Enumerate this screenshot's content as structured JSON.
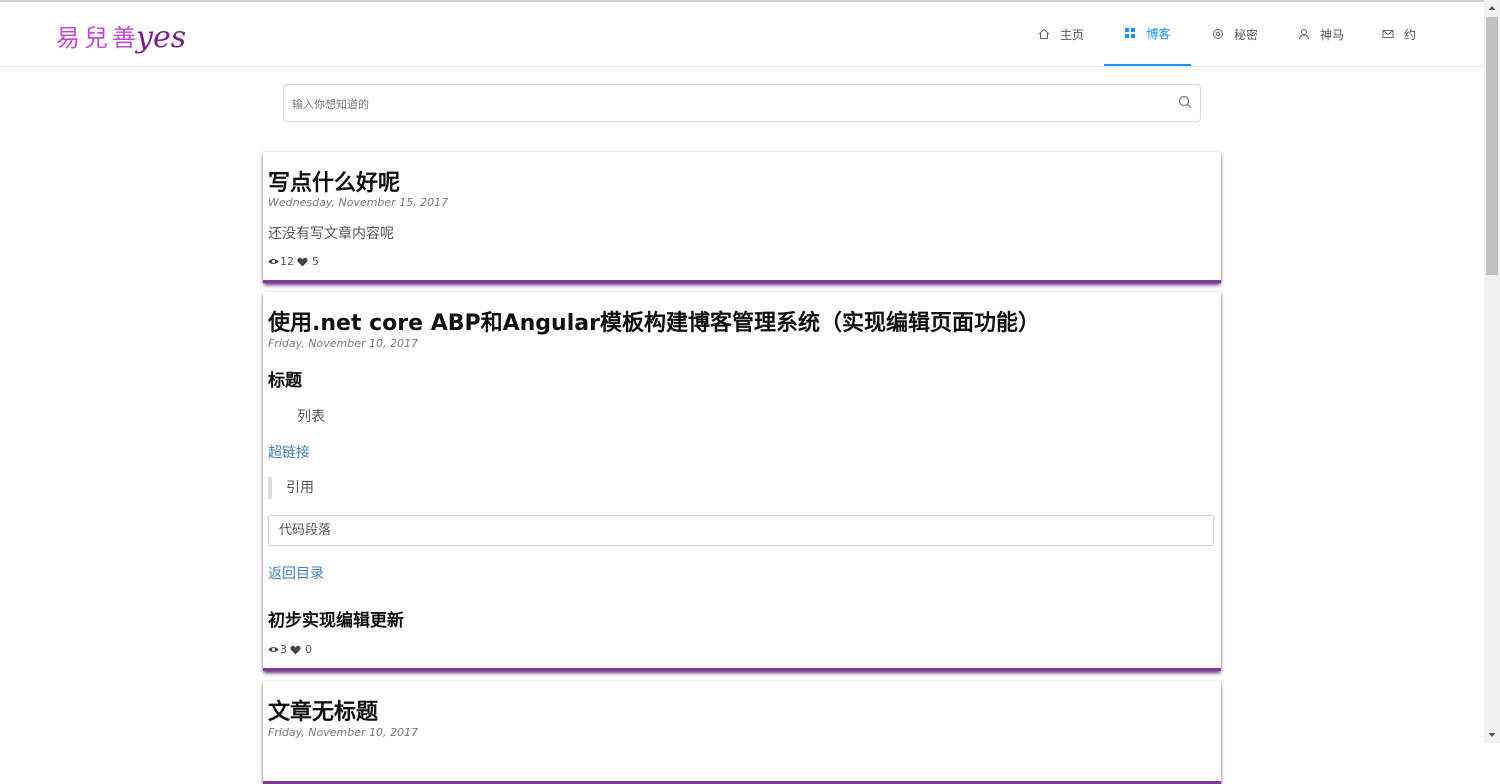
{
  "logo": {
    "cn": "易兒善",
    "en": "yes"
  },
  "nav": {
    "items": [
      {
        "label": "主页",
        "icon": "home-icon"
      },
      {
        "label": "博客",
        "icon": "appstore-icon",
        "active": true
      },
      {
        "label": "秘密",
        "icon": "setting-icon"
      },
      {
        "label": "神马",
        "icon": "user-icon"
      },
      {
        "label": "约",
        "icon": "mail-icon"
      }
    ]
  },
  "search": {
    "placeholder": "输入你想知道的",
    "icon": "search-icon"
  },
  "posts": [
    {
      "title": "写点什么好呢",
      "date": "Wednesday, November 15, 2017",
      "content": "还没有写文章内容呢",
      "views": "12",
      "likes": "5"
    },
    {
      "title": "使用.net core ABP和Angular模板构建博客管理系统（实现编辑页面功能）",
      "date": "Friday, November 10, 2017",
      "heading": "标题",
      "list_item": "列表",
      "link": "超链接",
      "quote": "引用",
      "code": "代码段落",
      "back_link": "返回目录",
      "heading2": "初步实现编辑更新",
      "views": "3",
      "likes": "0"
    },
    {
      "title": "文章无标题",
      "date": "Friday, November 10, 2017"
    }
  ],
  "colors": {
    "accent": "#1890ff",
    "card_border": "#7e3c96",
    "link": "#3f7fbf",
    "logo": "#c24bd6"
  }
}
